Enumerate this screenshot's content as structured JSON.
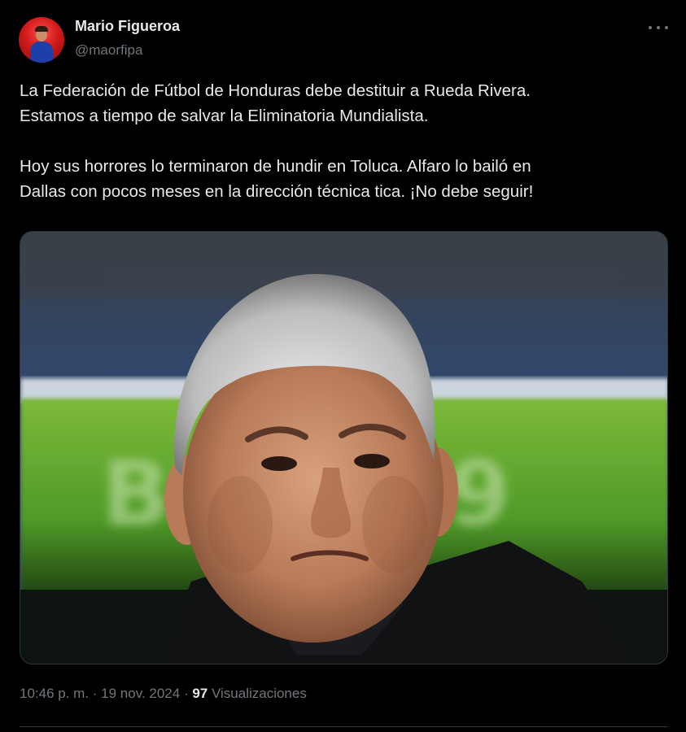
{
  "author": {
    "display_name": "Mario Figueroa",
    "handle": "@maorfipa"
  },
  "tweet": {
    "lines": [
      "La Federación de Fútbol de Honduras debe destituir a Rueda Rivera.",
      "Estamos a tiempo de salvar la Eliminatoria Mundialista.",
      "Hoy sus horrores lo terminaron de hundir en Toluca. Alfaro lo bailó en",
      "Dallas con pocos meses en la dirección técnica tica. ¡No debe seguir!"
    ],
    "photo_background_text": "Ba 2019"
  },
  "meta": {
    "time": "10:46 p. m.",
    "separator1": " · ",
    "date": "19 nov. 2024",
    "separator2": " · ",
    "views_count": "97",
    "views_label": " Visualizaciones"
  },
  "icons": {
    "more": "more-horizontal-icon"
  },
  "colors": {
    "background": "#000000",
    "text_primary": "#e7e9ea",
    "text_secondary": "#71767b",
    "border": "#2f3336"
  }
}
